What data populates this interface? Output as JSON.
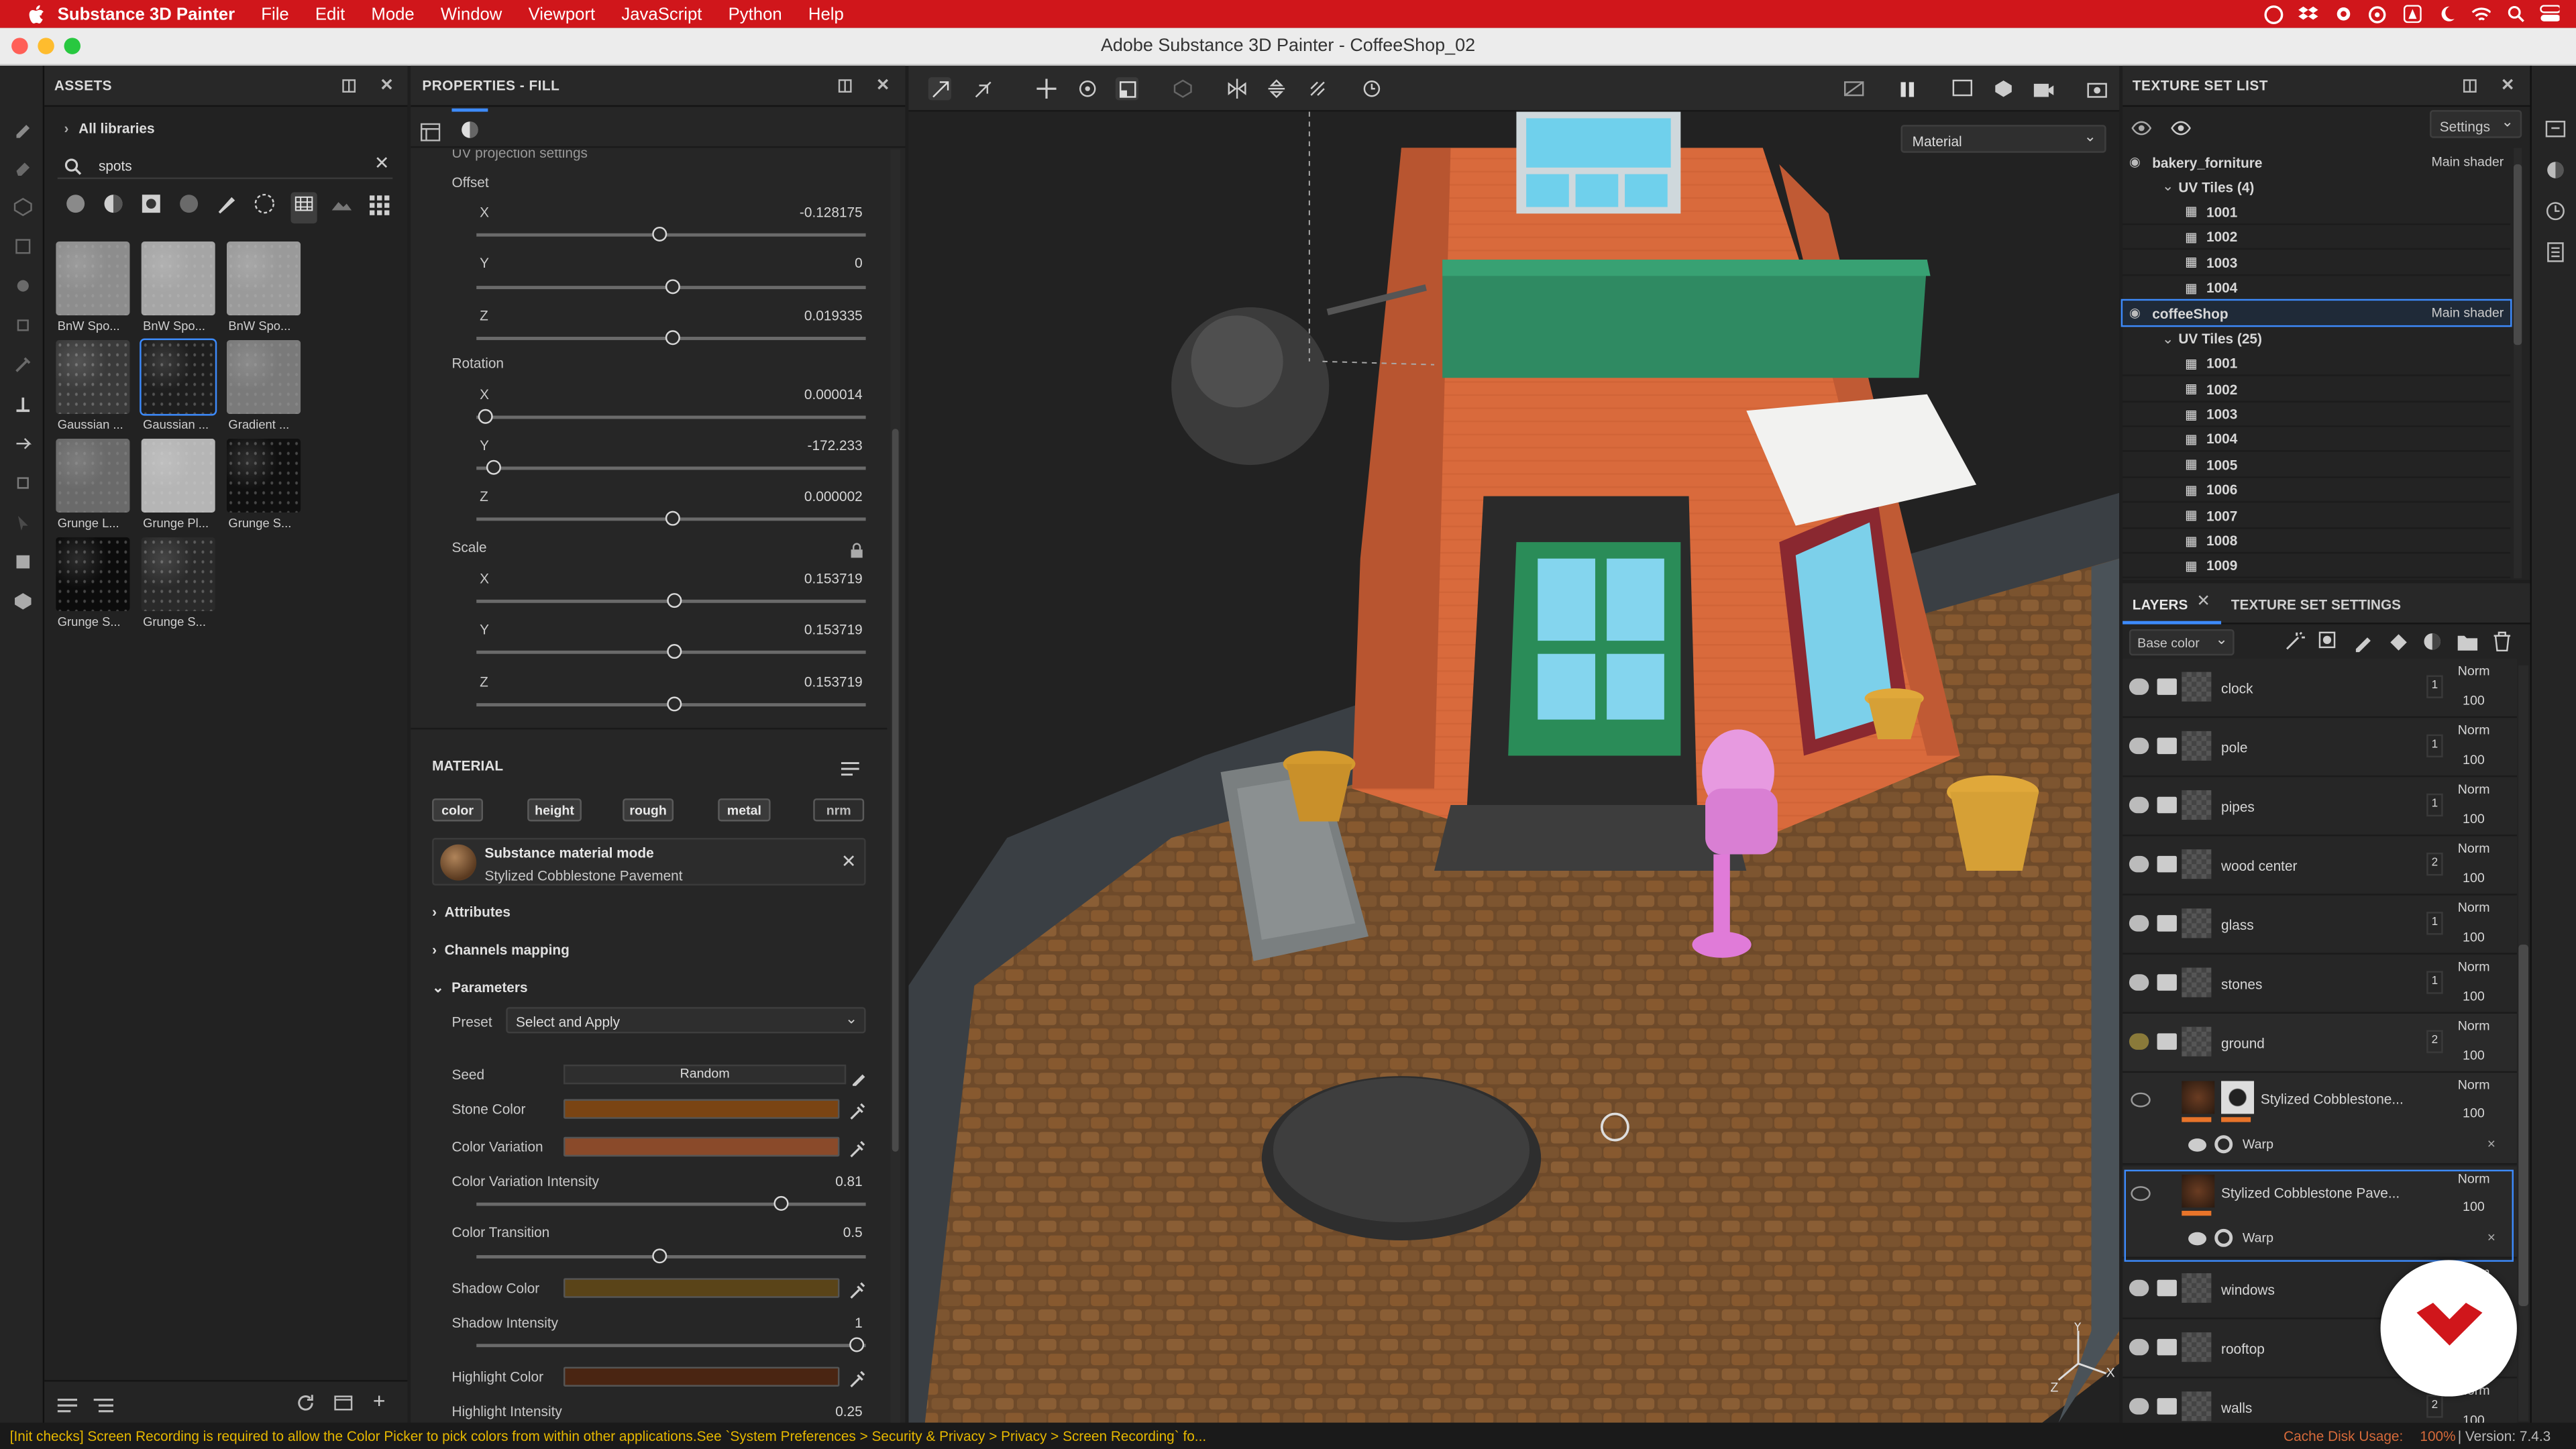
{
  "menubar": {
    "app": "Substance 3D Painter",
    "items": [
      "File",
      "Edit",
      "Mode",
      "Window",
      "Viewport",
      "JavaScript",
      "Python",
      "Help"
    ]
  },
  "window_title": "Adobe Substance 3D Painter - CoffeeShop_02",
  "assets": {
    "title": "ASSETS",
    "libraries": "All libraries",
    "search_value": "spots",
    "thumbs": [
      {
        "label": "BnW Spo...",
        "color": "#8d8d8d"
      },
      {
        "label": "BnW Spo...",
        "color": "#a5a5a5"
      },
      {
        "label": "BnW Spo...",
        "color": "#9a9a9a"
      },
      {
        "label": "Gaussian ...",
        "color": "#3a3a3a"
      },
      {
        "label": "Gaussian ...",
        "color": "#1e1e1e"
      },
      {
        "label": "Gradient ...",
        "color": "#7a7a7a"
      },
      {
        "label": "Grunge L...",
        "color": "#6a6a6a"
      },
      {
        "label": "Grunge Pl...",
        "color": "#b5b5b5"
      },
      {
        "label": "Grunge S...",
        "color": "#101010"
      },
      {
        "label": "Grunge S...",
        "color": "#0c0c0c"
      },
      {
        "label": "Grunge S...",
        "color": "#2a2a2a"
      }
    ]
  },
  "properties": {
    "title": "PROPERTIES - FILL",
    "section_cut": "UV projection settings",
    "offset_label": "Offset",
    "rotation_label": "Rotation",
    "scale_label": "Scale",
    "axis_x": "X",
    "axis_y": "Y",
    "axis_z": "Z",
    "offset": {
      "x": "-0.128175",
      "y": "0",
      "z": "0.019335"
    },
    "rotation": {
      "x": "0.000014",
      "y": "-172.233",
      "z": "0.000002"
    },
    "scale": {
      "x": "0.153719",
      "y": "0.153719",
      "z": "0.153719"
    },
    "material_title": "MATERIAL",
    "channels": [
      "color",
      "height",
      "rough",
      "metal",
      "nrm"
    ],
    "mode_title": "Substance material mode",
    "mode_name": "Stylized Cobblestone Pavement",
    "attributes": "Attributes",
    "channels_mapping": "Channels mapping",
    "parameters": "Parameters",
    "preset_label": "Preset",
    "preset_value": "Select and Apply",
    "seed_label": "Seed",
    "seed_value": "Random",
    "stone_color": "Stone Color",
    "color_variation": "Color Variation",
    "cvi_label": "Color Variation Intensity",
    "cvi_value": "0.81",
    "ct_label": "Color Transition",
    "ct_value": "0.5",
    "shadow_color": "Shadow Color",
    "si_label": "Shadow Intensity",
    "si_value": "1",
    "highlight_color": "Highlight Color",
    "hi_label": "Highlight Intensity",
    "hi_value": "0.25",
    "colors": {
      "stone": "#7a4413",
      "variation": "#8a4a2a",
      "shadow": "#5a4418",
      "highlight": "#4a2512"
    }
  },
  "viewport": {
    "channel_select": "Material"
  },
  "texture_set_list": {
    "title": "TEXTURE SET LIST",
    "settings": "Settings",
    "sets": [
      {
        "name": "bakery_forniture",
        "shader": "Main shader",
        "uv_label": "UV Tiles (4)",
        "tiles": [
          "1001",
          "1002",
          "1003",
          "1004"
        ]
      },
      {
        "name": "coffeeShop",
        "shader": "Main shader",
        "uv_label": "UV Tiles (25)",
        "tiles": [
          "1001",
          "1002",
          "1003",
          "1004",
          "1005",
          "1006",
          "1007",
          "1008",
          "1009"
        ]
      }
    ]
  },
  "layers": {
    "tab_layers": "LAYERS",
    "tab_tss": "TEXTURE SET SETTINGS",
    "channel": "Base color",
    "blend": "Norm",
    "opacity": "100",
    "rows": [
      {
        "name": "clock",
        "count": "1"
      },
      {
        "name": "pole",
        "count": "1"
      },
      {
        "name": "pipes",
        "count": "1"
      },
      {
        "name": "wood center",
        "count": "2"
      },
      {
        "name": "glass",
        "count": "1"
      },
      {
        "name": "stones",
        "count": "1"
      },
      {
        "name": "ground",
        "count": "2"
      }
    ],
    "fill1": "Stylized Cobblestone...",
    "fill2": "Stylized Cobblestone Pave...",
    "warp": "Warp",
    "rows_after": [
      {
        "name": "windows",
        "count": ""
      },
      {
        "name": "rooftop",
        "count": ""
      },
      {
        "name": "walls",
        "count": "2"
      }
    ]
  },
  "status": {
    "message": "[Init checks] Screen Recording is required to allow the Color Picker to pick colors from within other applications.See `System Preferences > Security & Privacy > Privacy > Screen Recording` fo...",
    "cache_label": "Cache Disk Usage:",
    "cache_value": "100%",
    "version": "| Version: 7.4.3"
  }
}
